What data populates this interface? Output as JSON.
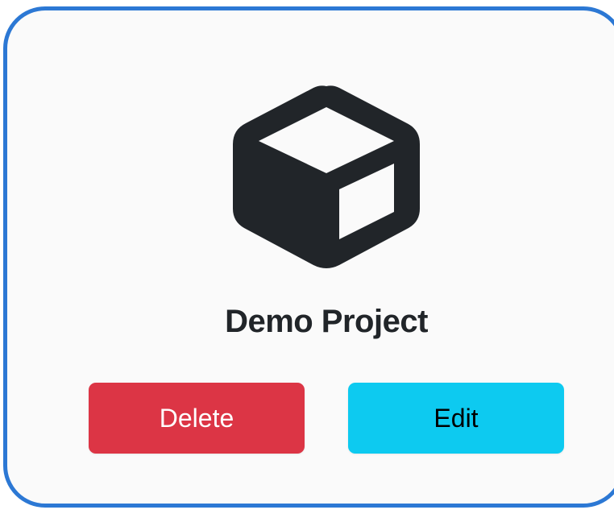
{
  "card": {
    "icon": "box-icon",
    "title": "Demo Project",
    "border_color": "#2c78d4"
  },
  "actions": {
    "delete_label": "Delete",
    "edit_label": "Edit",
    "delete_color": "#dc3545",
    "edit_color": "#0dcaf0"
  }
}
